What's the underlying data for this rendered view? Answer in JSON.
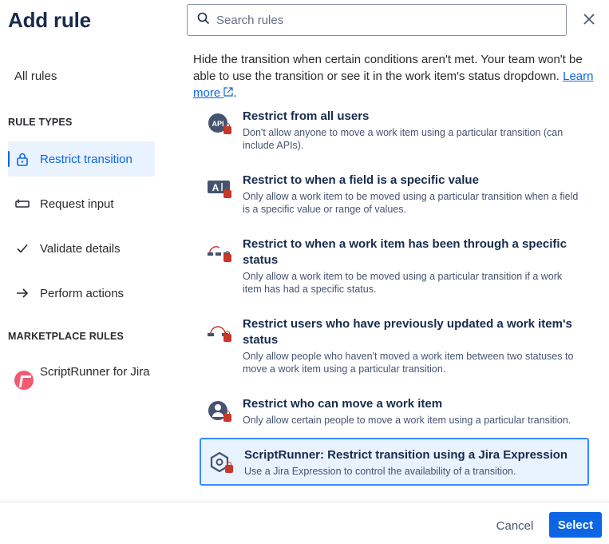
{
  "dialog": {
    "title": "Add rule"
  },
  "sidebar": {
    "all_rules": "All rules",
    "rule_types_heading": "RULE TYPES",
    "rule_types": [
      {
        "label": "Restrict transition",
        "icon": "lock-icon",
        "active": true
      },
      {
        "label": "Request input",
        "icon": "input-icon",
        "active": false
      },
      {
        "label": "Validate details",
        "icon": "check-icon",
        "active": false
      },
      {
        "label": "Perform actions",
        "icon": "arrow-right-icon",
        "active": false
      }
    ],
    "marketplace_heading": "MARKETPLACE RULES",
    "marketplace_items": [
      {
        "label": "ScriptRunner for Jira",
        "icon": "scriptrunner-logo-icon"
      }
    ]
  },
  "search": {
    "placeholder": "Search rules",
    "value": ""
  },
  "intro": {
    "text": "Hide the transition when certain conditions aren't met. Your team won't be able to use the transition or see it in the work item's status dropdown.",
    "link": "Learn more",
    "after_link": "."
  },
  "rules": [
    {
      "title": "Restrict from all users",
      "description": "Don't allow anyone to move a work item using a particular transition (can include APIs).",
      "icon": "api-lock-icon"
    },
    {
      "title": "Restrict to when a field is a specific value",
      "description": "Only allow a work item to be moved using a particular transition when a field is a specific value or range of values.",
      "icon": "field-lock-icon"
    },
    {
      "title": "Restrict to when a work item has been through a specific status",
      "description": "Only allow a work item to be moved using a particular transition if a work item has had a specific status.",
      "icon": "status-path-lock-icon"
    },
    {
      "title": "Restrict users who have previously updated a work item's status",
      "description": "Only allow people who haven't moved a work item between two statuses to move a work item using a particular transition.",
      "icon": "status-loop-lock-icon"
    },
    {
      "title": "Restrict who can move a work item",
      "description": "Only allow certain people to move a work item using a particular transition.",
      "icon": "user-lock-icon"
    },
    {
      "title": "ScriptRunner: Restrict transition using a Jira Expression",
      "description": "Use a Jira Expression to control the availability of a transition.",
      "icon": "scriptrunner-hex-lock-icon",
      "selected": true
    }
  ],
  "footer": {
    "cancel": "Cancel",
    "select": "Select"
  },
  "colors": {
    "accent": "#0c66e4",
    "selected_bg": "#e9f2ff",
    "lock_red": "#c9372c"
  }
}
